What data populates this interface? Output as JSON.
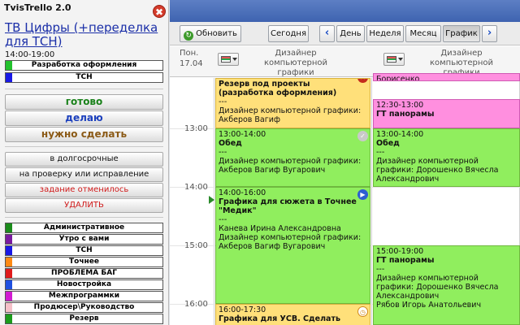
{
  "app": {
    "title": "TvisTrello 2.0",
    "close_glyph": "✖"
  },
  "task": {
    "title": "ТВ Цифры (+переделка для ТСН)",
    "time": "14:00-19:00",
    "tags": [
      {
        "label": "Разработка оформления",
        "color": "#22c12c"
      },
      {
        "label": "ТСН",
        "color": "#1818e6"
      }
    ]
  },
  "status_buttons": [
    {
      "label": "готово",
      "color": "#19811a"
    },
    {
      "label": "делаю",
      "color": "#1b3fbd"
    },
    {
      "label": "нужно сделать",
      "color": "#8b5a16"
    }
  ],
  "action_buttons": [
    {
      "label": "в долгосрочные",
      "color": "#111111"
    },
    {
      "label": "на проверку или исправление",
      "color": "#111111"
    },
    {
      "label": "задание отменилось",
      "color": "#d01b1b"
    },
    {
      "label": "УДАЛИТЬ",
      "color": "#d01b1b"
    }
  ],
  "categories": [
    {
      "label": "Административное",
      "color": "#1b8c1b"
    },
    {
      "label": "Утро с вами",
      "color": "#7a1aa0"
    },
    {
      "label": "ТСН",
      "color": "#1818e6"
    },
    {
      "label": "Точнее",
      "color": "#ff8a14"
    },
    {
      "label": "ПРОБЛЕМА БАГ",
      "color": "#e01b1b"
    },
    {
      "label": "Новостройка",
      "color": "#1f50e0"
    },
    {
      "label": "Межпрограммки",
      "color": "#d21bd2"
    },
    {
      "label": "Продюсер\\Руководство",
      "color": "#f5c0c8"
    },
    {
      "label": "Резерв",
      "color": "#1b9c1b"
    }
  ],
  "toolbar": {
    "refresh_label": "Обновить",
    "today_label": "Сегодня",
    "prev_glyph": "‹",
    "next_glyph": "›",
    "views": [
      "День",
      "Неделя",
      "Месяц",
      "График"
    ],
    "active_view": "График"
  },
  "calendar": {
    "day_name": "Пон.",
    "day_date": "17.04",
    "columns": [
      {
        "label": "Дизайнер компьютерной графики"
      },
      {
        "label": "Дизайнер компьютерной графики"
      }
    ],
    "hours": [
      "13:00",
      "14:00",
      "15:00",
      "16:00"
    ],
    "events_col1": [
      {
        "color": "yellow",
        "lines": [
          "Резерв под проекты (разработка оформления)",
          "---",
          "Дизайнер компьютерной графики: Акберов Вагиф"
        ]
      },
      {
        "color": "green",
        "time": "13:00-14:00",
        "title": "Обед",
        "lines": [
          "---",
          "Дизайнер компьютерной графики: Акберов Вагиф Вугарович"
        ]
      },
      {
        "color": "green",
        "time": "14:00-16:00",
        "title": "Графика для сюжета в Точнее \"Медик\"",
        "lines": [
          "---",
          "Канева Ирина Александровна",
          "Дизайнер компьютерной графики: Акберов Вагиф Вугарович"
        ]
      },
      {
        "color": "yellow",
        "time": "16:00-17:30",
        "title": "Графика для УСВ. Сделать"
      }
    ],
    "events_col2": [
      {
        "color": "pink",
        "lines": [
          "Борисенко"
        ]
      },
      {
        "color": "pink",
        "time": "12:30-13:00",
        "title": "ГТ панорамы"
      },
      {
        "color": "green",
        "time": "13:00-14:00",
        "title": "Обед",
        "lines": [
          "---",
          "Дизайнер компьютерной графики: Дорошенко Вячесла Александрович"
        ]
      },
      {
        "color": "green",
        "time": "15:00-19:00",
        "title": "ГТ панорамы",
        "lines": [
          "---",
          "Дизайнер компьютерной графики: Дорошенко Вячесла Александрович",
          "Рябов Игорь Анатольевич"
        ]
      }
    ]
  }
}
